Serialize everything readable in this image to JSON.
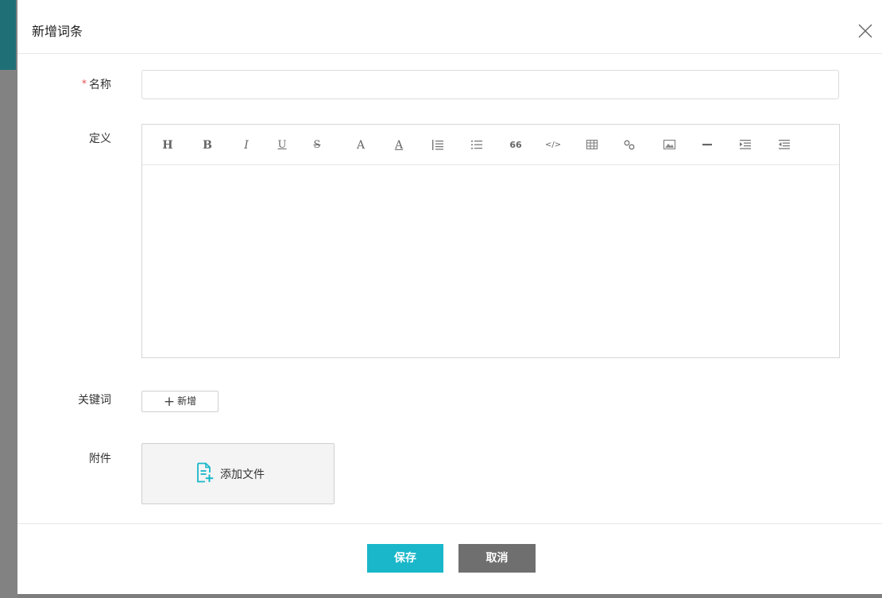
{
  "modal": {
    "title": "新增词条",
    "close_icon": "close-icon"
  },
  "form": {
    "name": {
      "required_mark": "*",
      "label": "名称",
      "value": "",
      "placeholder": ""
    },
    "definition": {
      "label": "定义",
      "toolbar": [
        {
          "key": "heading",
          "glyph": "H"
        },
        {
          "key": "bold",
          "glyph": "B"
        },
        {
          "key": "italic",
          "glyph": "I"
        },
        {
          "key": "underline",
          "glyph": "U"
        },
        {
          "key": "strikethrough",
          "glyph": "S"
        },
        {
          "key": "font-color",
          "glyph": "A"
        },
        {
          "key": "background-color",
          "glyph": "A"
        },
        {
          "key": "ordered-list",
          "icon": "ordered-list-icon"
        },
        {
          "key": "bullet-list",
          "icon": "bullet-list-icon"
        },
        {
          "key": "quote",
          "glyph": "66"
        },
        {
          "key": "code",
          "glyph": "</>"
        },
        {
          "key": "table",
          "icon": "table-icon"
        },
        {
          "key": "link",
          "icon": "link-icon"
        },
        {
          "key": "image",
          "icon": "image-icon"
        },
        {
          "key": "horizontal-rule",
          "icon": "horizontal-rule-icon"
        },
        {
          "key": "indent",
          "icon": "indent-icon"
        },
        {
          "key": "outdent",
          "icon": "outdent-icon"
        }
      ]
    },
    "keywords": {
      "label": "关键词",
      "plus": "+",
      "add_label": "新增"
    },
    "attachment": {
      "label": "附件",
      "add_file_label": "添加文件",
      "icon": "file-add-icon"
    }
  },
  "footer": {
    "save_label": "保存",
    "cancel_label": "取消"
  },
  "colors": {
    "accent": "#19b7c9",
    "cancel": "#6f6f6f",
    "required": "#e04b4b",
    "overlay": "#7d7d7d"
  }
}
